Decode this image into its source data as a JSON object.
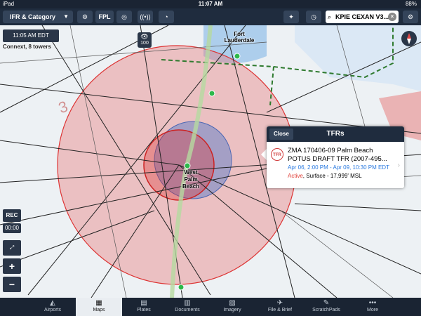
{
  "status_bar": {
    "device": "iPad",
    "time": "11:07 AM",
    "battery": "88%"
  },
  "toolbar": {
    "layer_label": "IFR & Category",
    "fpl_label": "FPL",
    "search_value": "KPIE CEXAN V3..."
  },
  "map": {
    "time_label": "11:05 AM EDT",
    "connection_label": "Connext, 8 towers",
    "eye_count": "100",
    "city_fort_lauderdale": "Fort\nLauderdale",
    "city_west_palm_beach": "West\nPalm\nBeach",
    "airspace_mark": "3",
    "rec_label": "REC",
    "timer_label": "00:00",
    "zoom_in": "+",
    "zoom_out": "−"
  },
  "tfr_popup": {
    "close_label": "Close",
    "title": "TFRs",
    "badge": "TFR",
    "tfr_name": "ZMA 170406-09 Palm Beach POTUS DRAFT TFR (2007-495...",
    "date_range": "Apr 06, 2:00 PM - Apr 09, 10:30 PM EDT",
    "status": "Active",
    "altitude": ", Surface - 17,999' MSL"
  },
  "tabs": [
    {
      "label": "Airports",
      "icon": "airport-icon"
    },
    {
      "label": "Maps",
      "icon": "map-icon"
    },
    {
      "label": "Plates",
      "icon": "plates-icon"
    },
    {
      "label": "Documents",
      "icon": "documents-icon"
    },
    {
      "label": "Imagery",
      "icon": "imagery-icon"
    },
    {
      "label": "File & Brief",
      "icon": "file-brief-icon"
    },
    {
      "label": "ScratchPads",
      "icon": "scratchpad-icon"
    },
    {
      "label": "More",
      "icon": "more-icon"
    }
  ],
  "colors": {
    "tfr_red": "#e04848",
    "accent_blue": "#2a7ae0",
    "toolbar": "#1f2c3e"
  }
}
